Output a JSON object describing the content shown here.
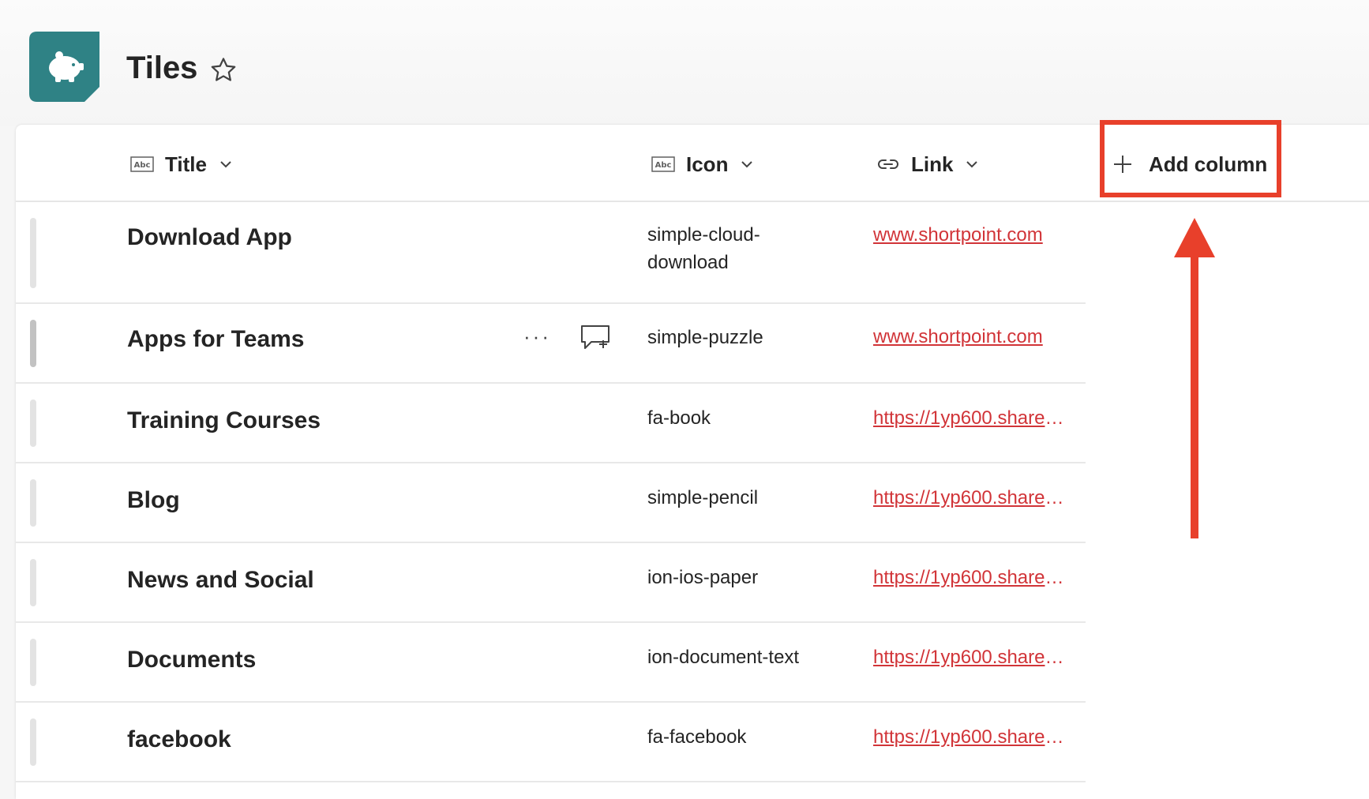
{
  "page": {
    "title": "Tiles",
    "logo_icon": "piggy-bank-icon",
    "favorite_icon": "star-outline-icon"
  },
  "columns": [
    {
      "label": "Title",
      "type_icon": "text-abc-icon"
    },
    {
      "label": "Icon",
      "type_icon": "text-abc-icon"
    },
    {
      "label": "Link",
      "type_icon": "link-icon"
    }
  ],
  "add_column": {
    "label": "Add column",
    "icon": "plus-icon"
  },
  "rows": [
    {
      "title": "Download App",
      "icon": "simple-cloud-download",
      "link": "www.shortpoint.com"
    },
    {
      "title": "Apps for Teams",
      "icon": "simple-puzzle",
      "link": "www.shortpoint.com",
      "more_label": "···"
    },
    {
      "title": "Training Courses",
      "icon": "fa-book",
      "link": "https://1yp600.sharepoint.com"
    },
    {
      "title": "Blog",
      "icon": "simple-pencil",
      "link": "https://1yp600.sharepoint.com"
    },
    {
      "title": "News and Social",
      "icon": "ion-ios-paper",
      "link": "https://1yp600.sharepoint.com"
    },
    {
      "title": "Documents",
      "icon": "ion-document-text",
      "link": "https://1yp600.sharepoint.com"
    },
    {
      "title": "facebook",
      "icon": "fa-facebook",
      "link": "https://1yp600.sharepoint.com"
    }
  ],
  "colors": {
    "accent": "#e8402b",
    "link": "#d13438",
    "logo": "#2f8285"
  }
}
